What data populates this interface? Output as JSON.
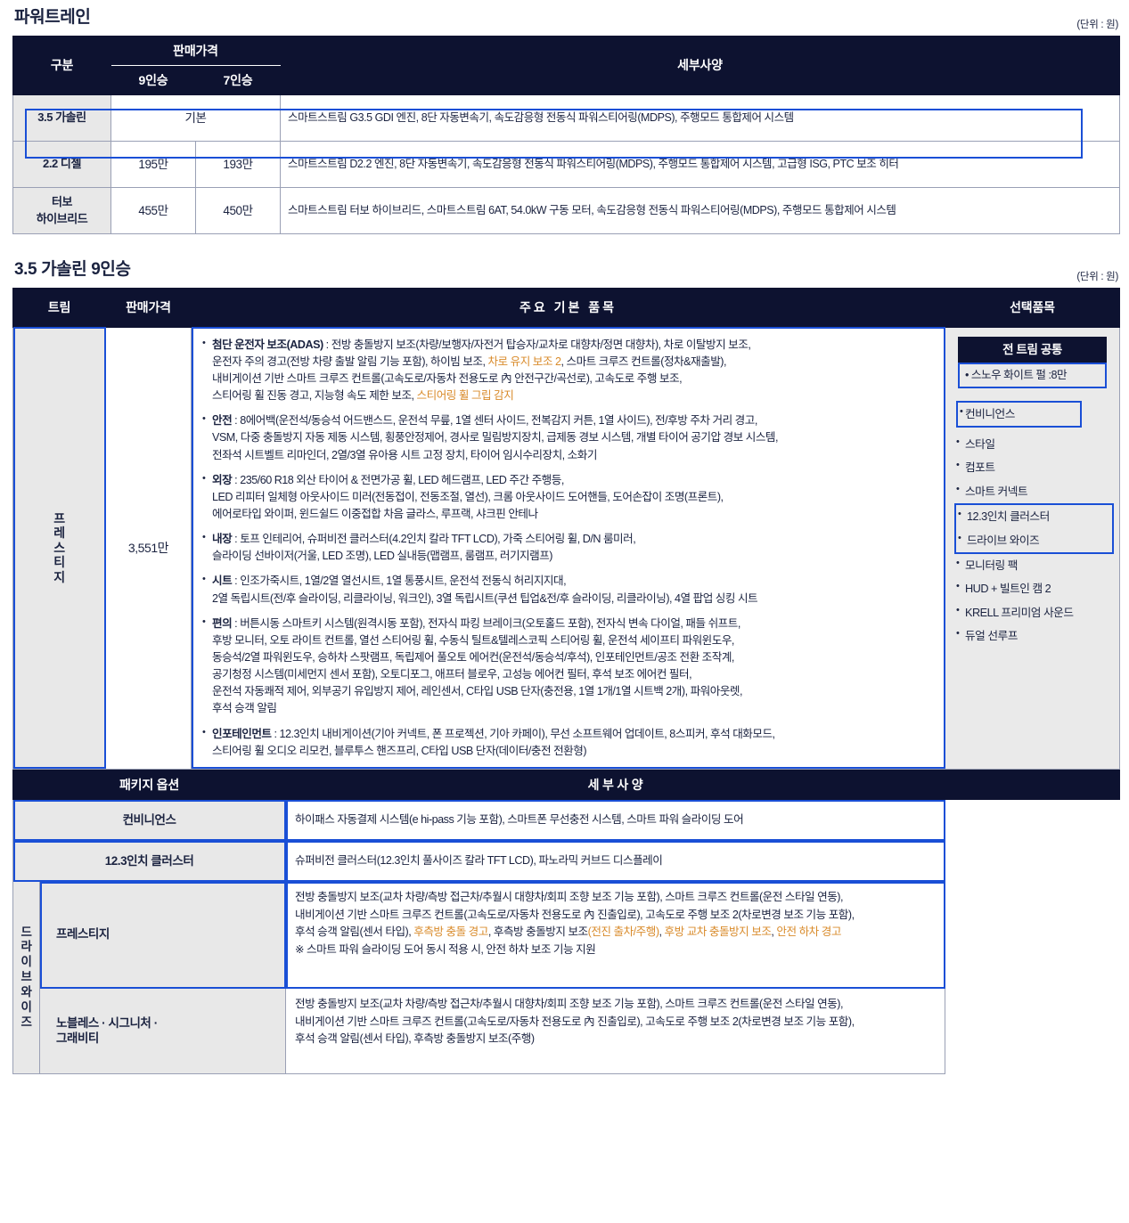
{
  "powertrain": {
    "section_title": "파워트레인",
    "unit_note": "(단위 : 원)",
    "headers": {
      "category": "구분",
      "price": "판매가격",
      "seat9": "9인승",
      "seat7": "7인승",
      "spec": "세부사양"
    },
    "rows": [
      {
        "category": "3.5 가솔린",
        "price9": "기본",
        "price7": "",
        "merged_price": true,
        "spec": "스마트스트림 G3.5 GDI 엔진, 8단 자동변속기, 속도감응형 전동식 파워스티어링(MDPS), 주행모드 통합제어 시스템",
        "highlighted": false
      },
      {
        "category": "2.2 디젤",
        "price9": "195만",
        "price7": "193만",
        "merged_price": false,
        "spec": "스마트스트림 D2.2 엔진, 8단 자동변속기, 속도감응형 전동식 파워스티어링(MDPS), 주행모드 통합제어 시스템, 고급형 ISG, PTC 보조 히터",
        "highlighted": true
      },
      {
        "category_line1": "터보",
        "category_line2": "하이브리드",
        "category": "터보 하이브리드",
        "price9": "455만",
        "price7": "450만",
        "merged_price": false,
        "spec": "스마트스트림 터보 하이브리드, 스마트스트림 6AT, 54.0kW 구동 모터, 속도감응형 전동식 파워스티어링(MDPS), 주행모드 통합제어 시스템",
        "highlighted": false
      }
    ]
  },
  "trim_section": {
    "section_title": "3.5 가솔린 9인승",
    "unit_note": "(단위 : 원)",
    "headers": {
      "trim": "트림",
      "price": "판매가격",
      "main_items": "주요 기본 품목",
      "options": "선택품목"
    },
    "trim": {
      "name_chars": [
        "프",
        "레",
        "스",
        "티",
        "지"
      ],
      "name": "프레스티지",
      "price": "3,551만"
    },
    "item_groups": [
      {
        "category": "첨단 운전자 보조(ADAS)",
        "separator": " : ",
        "lines": [
          [
            {
              "t": "전방 충돌방지 보조(차량/보행자/자전거 탑승자/교차로 대향차/정면 대향차), 차로 이탈방지 보조,",
              "hl": false
            }
          ],
          [
            {
              "t": "운전자 주의 경고(전방 차량 출발 알림 기능 포함), 하이빔 보조, ",
              "hl": false
            },
            {
              "t": "차로 유지 보조 2",
              "hl": true
            },
            {
              "t": ", 스마트 크루즈 컨트롤(정차&재출발),",
              "hl": false
            }
          ],
          [
            {
              "t": "내비게이션 기반 스마트 크루즈 컨트롤(고속도로/자동차 전용도로 內 안전구간/곡선로), 고속도로 주행 보조,",
              "hl": false
            }
          ],
          [
            {
              "t": "스티어링 휠 진동 경고, 지능형 속도 제한 보조, ",
              "hl": false
            },
            {
              "t": "스티어링 휠 그립 감지",
              "hl": true
            }
          ]
        ]
      },
      {
        "category": "안전",
        "separator": " : ",
        "lines": [
          [
            {
              "t": "8에어백(운전석/동승석 어드밴스드, 운전석 무릎, 1열 센터 사이드, 전복감지 커튼, 1열 사이드), 전/후방 주차 거리 경고,",
              "hl": false
            }
          ],
          [
            {
              "t": "VSM, 다중 충돌방지 자동 제동 시스템, 횡풍안정제어, 경사로 밀림방지장치, 급제동 경보 시스템, 개별 타이어 공기압 경보 시스템,",
              "hl": false
            }
          ],
          [
            {
              "t": "전좌석 시트벨트 리마인더, 2열/3열 유아용 시트 고정 장치, 타이어 임시수리장치, 소화기",
              "hl": false
            }
          ]
        ]
      },
      {
        "category": "외장",
        "separator": " : ",
        "lines": [
          [
            {
              "t": "235/60 R18 외산 타이어 & 전면가공 휠, LED 헤드램프, LED 주간 주행등,",
              "hl": false
            }
          ],
          [
            {
              "t": "LED 리피터 일체형 아웃사이드 미러(전동접이, 전동조절, 열선), 크롬 아웃사이드 도어핸들, 도어손잡이 조명(프론트),",
              "hl": false
            }
          ],
          [
            {
              "t": "에어로타입 와이퍼, 윈드쉴드 이중접합 차음 글라스, 루프랙, 샤크핀 안테나",
              "hl": false
            }
          ]
        ]
      },
      {
        "category": "내장",
        "separator": " : ",
        "lines": [
          [
            {
              "t": "토프 인테리어, 슈퍼비전 클러스터(4.2인치 칼라 TFT LCD), 가죽 스티어링 휠, D/N 룸미러,",
              "hl": false
            }
          ],
          [
            {
              "t": "슬라이딩 선바이저(거울, LED 조명), LED 실내등(맵램프, 룸램프, 러기지램프)",
              "hl": false
            }
          ]
        ]
      },
      {
        "category": "시트",
        "separator": " : ",
        "lines": [
          [
            {
              "t": "인조가죽시트, 1열/2열 열선시트, 1열 통풍시트, 운전석 전동식 허리지지대,",
              "hl": false
            }
          ],
          [
            {
              "t": "2열 독립시트(전/후 슬라이딩, 리클라이닝, 워크인), 3열 독립시트(쿠션 팁업&전/후 슬라이딩, 리클라이닝), 4열 팝업 싱킹 시트",
              "hl": false
            }
          ]
        ]
      },
      {
        "category": "편의",
        "separator": " : ",
        "lines": [
          [
            {
              "t": "버튼시동 스마트키 시스템(원격시동 포함), 전자식 파킹 브레이크(오토홀드 포함), 전자식 변속 다이얼, 패들 쉬프트,",
              "hl": false
            }
          ],
          [
            {
              "t": "후방 모니터, 오토 라이트 컨트롤, 열선 스티어링 휠, 수동식 틸트&텔레스코픽 스티어링 휠, 운전석 세이프티 파워윈도우,",
              "hl": false
            }
          ],
          [
            {
              "t": "동승석/2열 파워윈도우, 승하차 스팟램프, 독립제어 풀오토 에어컨(운전석/동승석/후석), 인포테인먼트/공조 전환 조작계,",
              "hl": false
            }
          ],
          [
            {
              "t": "공기청정 시스템(미세먼지 센서 포함), 오토디포그, 애프터 블로우, 고성능 에어컨 필터, 후석 보조 에어컨 필터,",
              "hl": false
            }
          ],
          [
            {
              "t": "운전석 자동쾌적 제어, 외부공기 유입방지 제어, 레인센서, C타입 USB 단자(충전용, 1열 1개/1열 시트백 2개), 파워아웃렛,",
              "hl": false
            }
          ],
          [
            {
              "t": "후석 승객 알림",
              "hl": false
            }
          ]
        ]
      },
      {
        "category": "인포테인먼트",
        "separator": " : ",
        "lines": [
          [
            {
              "t": "12.3인치 내비게이션(기아 커넥트, 폰 프로젝션, 기아 카페이), 무선 소프트웨어 업데이트, 8스피커, 후석 대화모드,",
              "hl": false
            }
          ],
          [
            {
              "t": "스티어링 휠 오디오 리모컨, 블루투스 핸즈프리, C타입 USB 단자(데이터/충전 전환형)",
              "hl": false
            }
          ]
        ]
      }
    ],
    "options": {
      "common_header": "전 트림 공통",
      "common_item": "스노우 화이트 펄  :8만",
      "list": [
        {
          "label": "컨비니언스",
          "boxed": "single"
        },
        {
          "label": "스타일",
          "boxed": "none"
        },
        {
          "label": "컴포트",
          "boxed": "none"
        },
        {
          "label": "스마트 커넥트",
          "boxed": "none"
        },
        {
          "label": "12.3인치 클러스터",
          "boxed": "pair-start"
        },
        {
          "label": "드라이브 와이즈",
          "boxed": "pair-end"
        },
        {
          "label": "모니터링 팩",
          "boxed": "none"
        },
        {
          "label": "HUD + 빌트인 캠 2",
          "boxed": "none"
        },
        {
          "label": "KRELL 프리미엄 사운드",
          "boxed": "none"
        },
        {
          "label": "듀얼 선루프",
          "boxed": "none"
        }
      ]
    }
  },
  "package_section": {
    "headers": {
      "option": "패키지 옵션",
      "detail": "세 부 사 양"
    },
    "rows": [
      {
        "label": "컨비니언스",
        "boxed": true,
        "lines": [
          [
            {
              "t": "하이패스 자동결제 시스템(e hi-pass 기능 포함), 스마트폰 무선충전 시스템, 스마트 파워 슬라이딩 도어",
              "hl": false
            }
          ]
        ]
      },
      {
        "label": "12.3인치 클러스터",
        "boxed": true,
        "lines": [
          [
            {
              "t": "슈퍼비전 클러스터(12.3인치 풀사이즈 칼라 TFT LCD), 파노라믹 커브드 디스플레이",
              "hl": false
            }
          ]
        ]
      }
    ],
    "drive_wise": {
      "group_label_line1": "드라이브",
      "group_label_line2": "와이즈",
      "group_label": "드라이브 와이즈",
      "sub_rows": [
        {
          "label": "프레스티지",
          "label_lines": [
            "프레스티지"
          ],
          "boxed": true,
          "lines": [
            [
              {
                "t": "전방 충돌방지 보조(교차 차량/측방 접근차/추월시 대향차/회피 조향 보조 기능 포함), 스마트 크루즈 컨트롤(운전 스타일 연동),",
                "hl": false
              }
            ],
            [
              {
                "t": "내비게이션 기반 스마트 크루즈 컨트롤(고속도로/자동차 전용도로 內 진출입로), 고속도로 주행 보조 2(차로변경 보조 기능 포함),",
                "hl": false
              }
            ],
            [
              {
                "t": "후석 승객 알림(센서 타입), ",
                "hl": false
              },
              {
                "t": "후측방 충돌 경고",
                "hl": true
              },
              {
                "t": ", 후측방 충돌방지 보조",
                "hl": false
              },
              {
                "t": "(전진 출차/주행)",
                "hl": true
              },
              {
                "t": ", ",
                "hl": false
              },
              {
                "t": "후방 교차 충돌방지 보조",
                "hl": true
              },
              {
                "t": ", ",
                "hl": false
              },
              {
                "t": "안전 하차 경고",
                "hl": true
              }
            ],
            [
              {
                "t": "※ 스마트 파워 슬라이딩 도어 동시 적용 시, 안전 하차 보조 기능 지원",
                "hl": false
              }
            ]
          ]
        },
        {
          "label": "노블레스·시그니처·그래비티",
          "label_lines": [
            "노블레스 · 시그니처 ·",
            "그래비티"
          ],
          "boxed": false,
          "lines": [
            [
              {
                "t": "전방 충돌방지 보조(교차 차량/측방 접근차/추월시 대향차/회피 조향 보조 기능 포함), 스마트 크루즈 컨트롤(운전 스타일 연동),",
                "hl": false
              }
            ],
            [
              {
                "t": "내비게이션 기반 스마트 크루즈 컨트롤(고속도로/자동차 전용도로 內 진출입로), 고속도로 주행 보조 2(차로변경 보조 기능 포함),",
                "hl": false
              }
            ],
            [
              {
                "t": "후석 승객 알림(센서 타입), 후측방 충돌방지 보조(주행)",
                "hl": false
              }
            ]
          ]
        }
      ]
    }
  },
  "colors": {
    "header_bg": "#0d1230",
    "label_bg": "#e8e8e8",
    "highlight_border": "#1a4fd6",
    "highlight_text": "#d98b2b",
    "body_text": "#1b2340"
  }
}
